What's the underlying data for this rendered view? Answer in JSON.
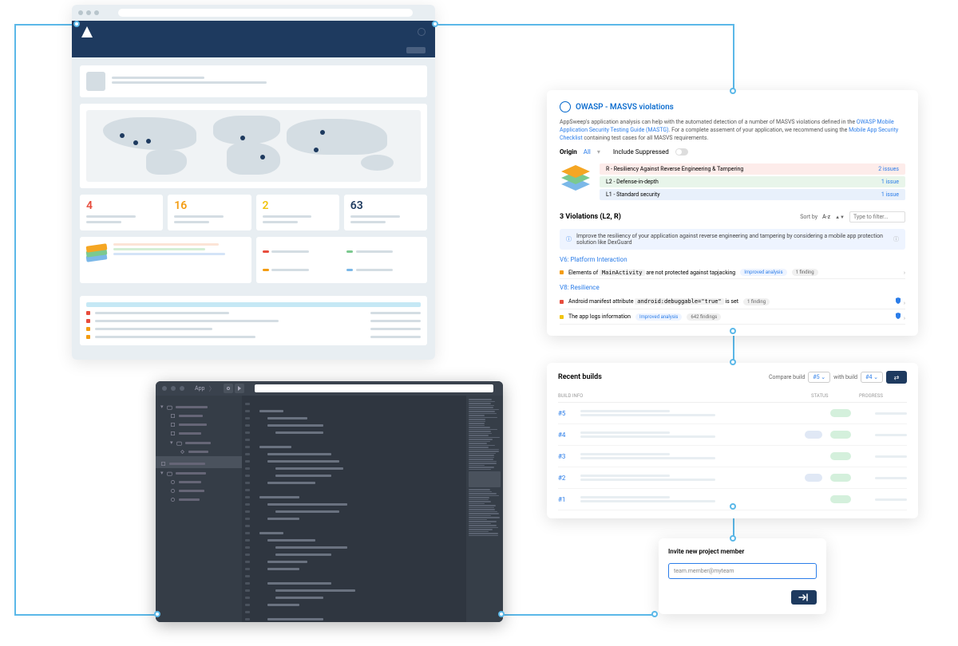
{
  "dashboard": {
    "stats": [
      {
        "value": "4",
        "color": "#e74c3c"
      },
      {
        "value": "16",
        "color": "#f39c12"
      },
      {
        "value": "2",
        "color": "#f1c40f"
      },
      {
        "value": "63",
        "color": "#1e3a5f"
      }
    ]
  },
  "owasp": {
    "title": "OWASP - MASVS violations",
    "desc_pre": "AppSweep's application analysis can help with the automated detection of a number of MASVS violations defined in the ",
    "link1": "OWASP Mobile Application Security Testing Guide (MASTG)",
    "desc_mid": ". For a complete assement of your application, we recommend using the ",
    "link2": "Mobile App Security Checklist",
    "desc_post": " containing test cases for all MASVS requirements.",
    "origin_label": "Origin",
    "origin_value": "All",
    "suppress_label": "Include Suppressed",
    "levels": [
      {
        "label": "R - Resiliency Against Reverse Engineering & Tampering",
        "count": "2 issues",
        "bg": "#fdecea"
      },
      {
        "label": "L2 - Defense-in-depth",
        "count": "1 issue",
        "bg": "#e8f5ea"
      },
      {
        "label": "L1 - Standard security",
        "count": "1 issue",
        "bg": "#e8f0fb"
      }
    ],
    "violations_count": "3 Violations (L2, R)",
    "sort_label": "Sort by",
    "sort_value": "A-z",
    "filter_placeholder": "Type to filter...",
    "tip": "Improve the resiliency of your application against reverse engineering and tampering by considering a mobile app protection solution like DexGuard",
    "sections": [
      {
        "title": "V6: Platform Interaction",
        "items": [
          {
            "dot": "#f39c12",
            "text_pre": "Elements of ",
            "code": "MainActivity",
            "text_post": " are not protected against tapjacking",
            "tags": [
              {
                "t": "Improved analysis",
                "c": "blue"
              },
              {
                "t": "1 finding",
                "c": "grey"
              }
            ],
            "shield": false
          }
        ]
      },
      {
        "title": "V8: Resilience",
        "items": [
          {
            "dot": "#e74c3c",
            "text_pre": "Android manifest attribute ",
            "code": "android:debuggable=\"true\"",
            "text_post": " is set",
            "tags": [
              {
                "t": "1 finding",
                "c": "grey"
              }
            ],
            "shield": true
          },
          {
            "dot": "#f1c40f",
            "text_pre": "The app logs information",
            "code": "",
            "text_post": "",
            "tags": [
              {
                "t": "Improved analysis",
                "c": "blue"
              },
              {
                "t": "642 findings",
                "c": "grey"
              }
            ],
            "shield": true
          }
        ]
      }
    ]
  },
  "builds": {
    "title": "Recent builds",
    "compare_label": "Compare build",
    "with_label": "with build",
    "select1": "#5",
    "select2": "#4",
    "cols": {
      "c1": "BUILD INFO",
      "c2": "STATUS",
      "c3": "PROGRESS"
    },
    "rows": [
      {
        "id": "#5",
        "tag": false
      },
      {
        "id": "#4",
        "tag": true
      },
      {
        "id": "#3",
        "tag": false
      },
      {
        "id": "#2",
        "tag": true
      },
      {
        "id": "#1",
        "tag": false
      }
    ]
  },
  "ide": {
    "app_label": "App"
  },
  "invite": {
    "title": "Invite new project member",
    "placeholder": "team.member@myteam"
  }
}
